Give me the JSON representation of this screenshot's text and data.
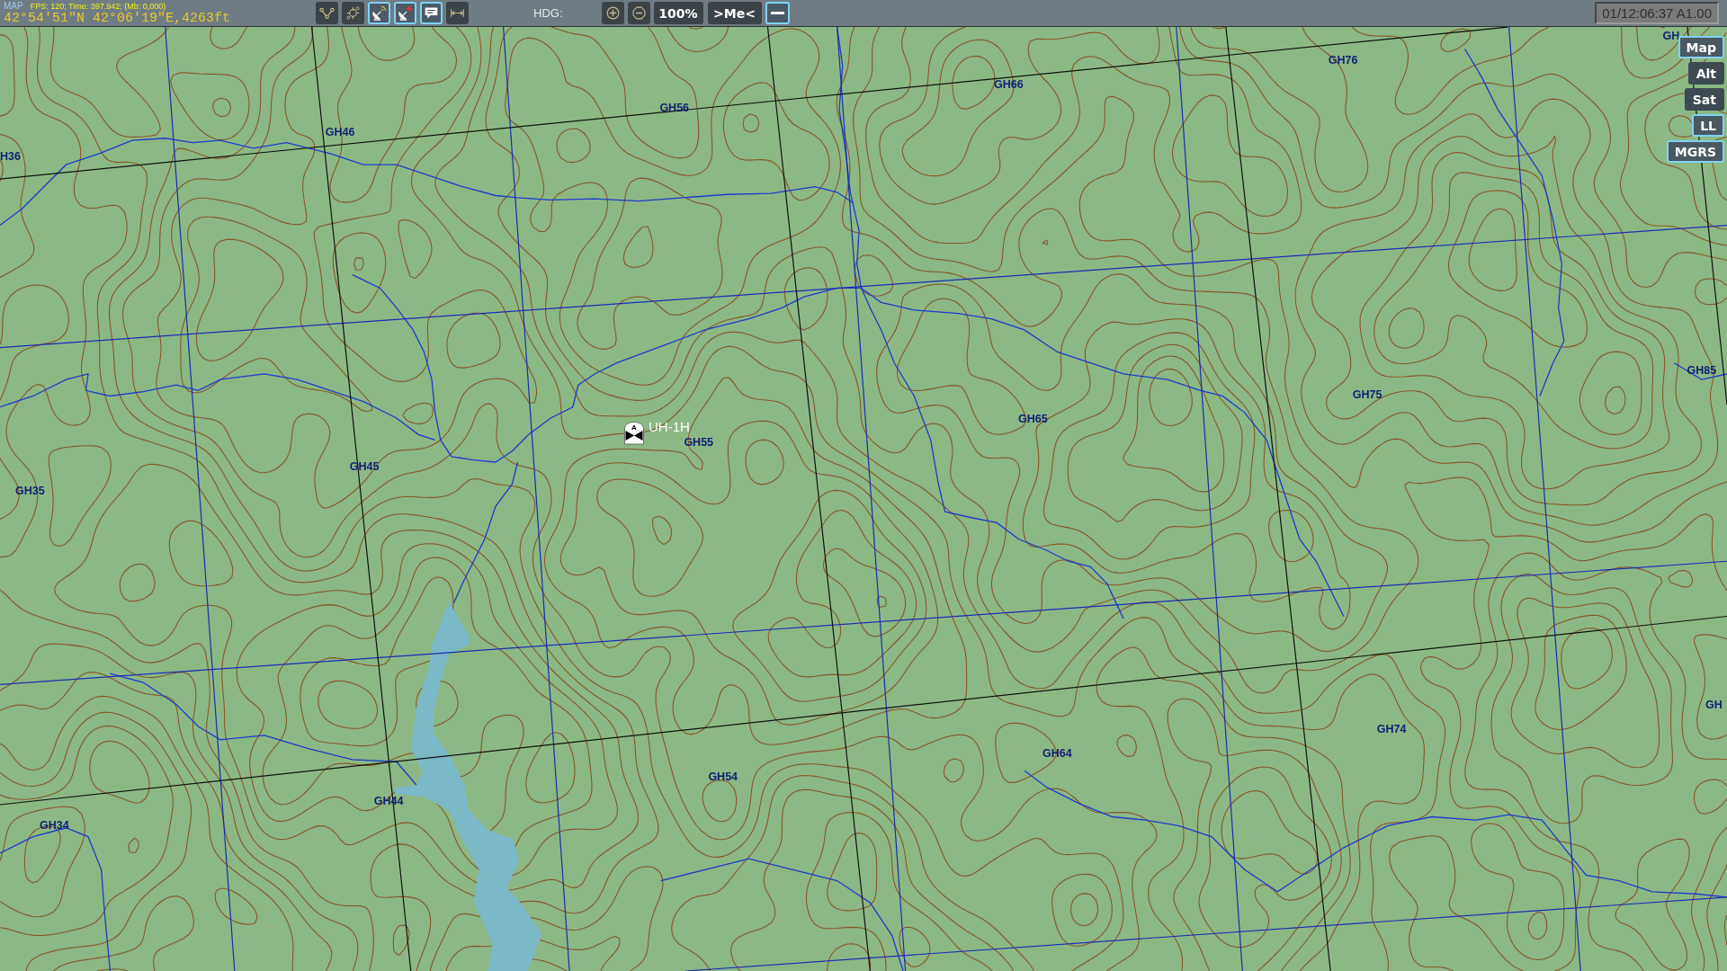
{
  "top_bar": {
    "title": "MAP",
    "fps": "FPS: 120; Time: 397.942; (Mb: 0,000)",
    "cursor_position": "42°54'51\"N 42°06'19\"E,4263ft",
    "tools": [
      {
        "selected": false
      },
      {
        "selected": false
      },
      {
        "selected": true
      },
      {
        "selected": true
      },
      {
        "selected": true
      },
      {
        "selected": false
      }
    ],
    "heading_label": "HDG:",
    "zoom_level": "100%",
    "center_button": ">Me<",
    "panel_toggle": {
      "selected": true
    },
    "mission_time": "01/12:06:37 A1.00"
  },
  "map": {
    "grid_labels": [
      "H36",
      "GH46",
      "GH56",
      "GH66",
      "GH76",
      "GH",
      "GH35",
      "GH45",
      "GH55",
      "GH65",
      "GH75",
      "GH85",
      "GH34",
      "GH44",
      "GH54",
      "GH64",
      "GH74",
      "GH"
    ],
    "unit": {
      "symbol": "A",
      "label": "UH-1H"
    },
    "map_modes": [
      {
        "label": "Map",
        "selected": true
      },
      {
        "label": "Alt",
        "selected": false
      },
      {
        "label": "Sat",
        "selected": false
      }
    ],
    "coordinate_formats": [
      {
        "label": "LL",
        "selected": true
      },
      {
        "label": "MGRS",
        "selected": true
      }
    ]
  }
}
